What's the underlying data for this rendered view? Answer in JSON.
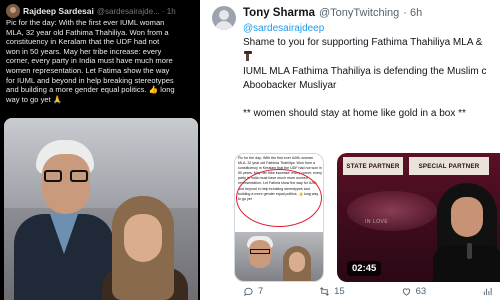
{
  "left_tweet": {
    "author_name": "Rajdeep Sardesai",
    "handle_time": "@sardesairajde... · 1h",
    "line1": "Pic for the day: With the first ever IUML woman",
    "line2": "MLA, 32 year old Fathima Thahiliya. Won from a",
    "line3": "constituency in Keralam that the UDF had not",
    "line4": "won in 50 years. May her tribe increase: every",
    "line5": "corner, every party in India must have much more",
    "line6": "women representation. Let Fatima show the way",
    "line7": "for IUML and beyond in help breaking stereotypes",
    "line8_start": "and building a more gender equal politics.",
    "line8_end": "long",
    "line9": "way to go yet",
    "like_emoji": "👍",
    "pray_emoji": "🙏"
  },
  "right_tweet": {
    "author_name": "Tony Sharma",
    "handle": "@TonyTwitching",
    "time": "· 6h",
    "mention_line": "@sardesairajdeep",
    "line1": "Shame to you for supporting Fathima Thahiliya MLA &",
    "line2": "IUML MLA Fathima Thahiliya is defending the Muslim c",
    "line3": "Aboobacker Musliyar",
    "line4": "**  women should stay at home like gold in a box  **",
    "screenshot_text": "Pic for the day: With the first ever IUML woman MLA, 32 year old Fathima Thahiliya. Won from a constituency in Keralam that the UDF had not won in 50 years. May her tribe increase: every corner, every party in India must have much more women representation. Let Fatima show the way for IUML and beyond in help breaking stereotypes and building a more gender equal politics. 👍 long way to go yet",
    "video": {
      "banner_1": "State Partner",
      "banner_2": "Special Partner",
      "stage_text": "IN LOVE",
      "duration": "02:45"
    },
    "actions": {
      "replies": "7",
      "reposts": "15",
      "likes": "63"
    }
  },
  "colors": {
    "link_blue": "#1d9bf0",
    "dark_bg": "#000000",
    "light_bg": "#ffffff",
    "red_circle": "#e11d2e"
  },
  "icons": [
    "dagger-icon",
    "reply-icon",
    "repost-icon",
    "like-icon",
    "views-icon"
  ]
}
